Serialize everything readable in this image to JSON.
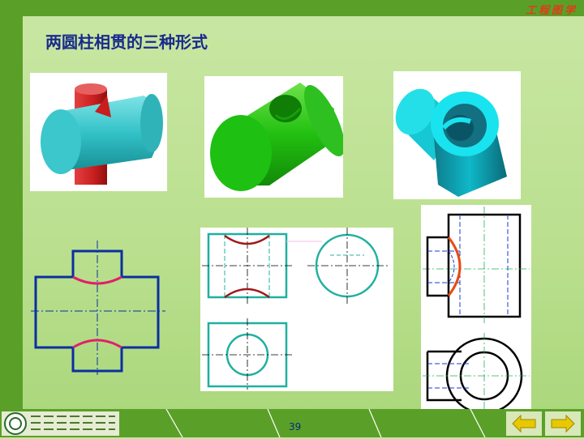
{
  "header_tag": "工程图学",
  "title": "两圆柱相贯的三种形式",
  "page_number": "39",
  "footer": {
    "logo_icon": "university-logo-icon"
  },
  "navigation": {
    "prev_icon": "arrow-left-icon",
    "next_icon": "arrow-right-icon",
    "arrow_color": "#e8c800"
  },
  "colors": {
    "title": "#1a2a8c",
    "header_tag": "#e23a1a",
    "background": "#c8e6a0",
    "band": "#5aa028",
    "outline_blue": "#0a30a0",
    "curve_magenta": "#e0206a",
    "teal": "#20b0a0",
    "curve_red": "#a01818",
    "curve_orange": "#e84a10"
  },
  "figures": [
    {
      "name": "red-cylinder-through-cyan-cylinder-3d"
    },
    {
      "name": "green-cylinder-with-hole-3d"
    },
    {
      "name": "cyan-hollow-cylinders-3d"
    },
    {
      "name": "cross-shaped-outline-view"
    },
    {
      "name": "cylinder-hole-three-views"
    },
    {
      "name": "pipe-intersection-views"
    }
  ]
}
